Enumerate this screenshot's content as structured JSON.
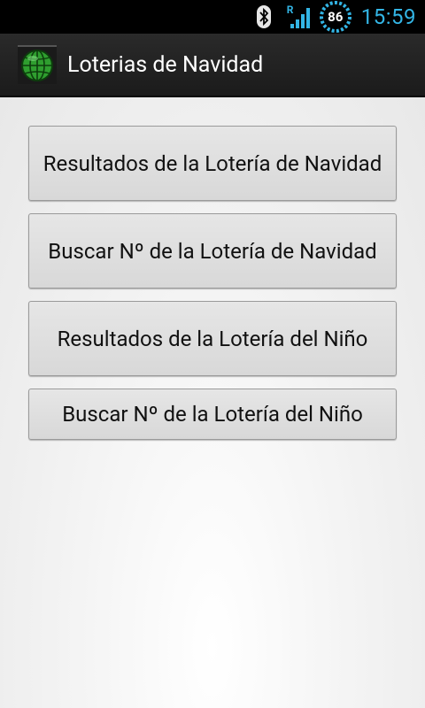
{
  "status_bar": {
    "battery_level": "86",
    "roaming_indicator": "R",
    "time": "15:59",
    "icons": [
      "bluetooth-icon",
      "signal-icon",
      "battery-icon"
    ]
  },
  "action_bar": {
    "title": "Loterias de Navidad",
    "icon": "globe-icon"
  },
  "buttons": [
    {
      "label": "Resultados de la Lotería de Navidad"
    },
    {
      "label": "Buscar Nº de la Lotería de Navidad"
    },
    {
      "label": "Resultados de la Lotería del Niño"
    },
    {
      "label": "Buscar Nº de la Lotería del Niño"
    }
  ],
  "colors": {
    "accent": "#33b5e5",
    "status_bar_bg": "#000000",
    "action_bar_bg": "#1f1f1f",
    "button_bg": "#dedede",
    "globe_green": "#3fbf3f"
  }
}
